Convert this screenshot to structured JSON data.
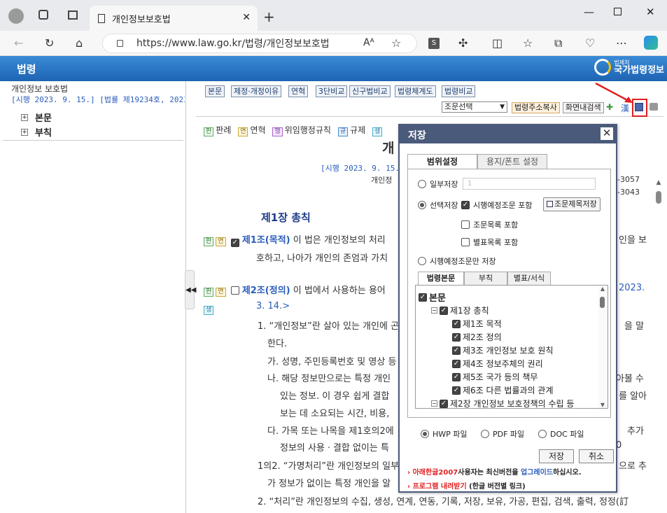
{
  "browser": {
    "tab_title": "개인정보보호법",
    "url_host": "https://www.law.go.kr",
    "url_path": "/법령/개인정보보호법"
  },
  "site": {
    "section": "법령",
    "logo_sub": "법제처",
    "logo_main": "국가법령정보"
  },
  "sidebar": {
    "law_name": "개인정보 보호법",
    "law_sub": "[시행 2023. 9. 15.] [법률 제19234호, 2023. 3.",
    "items": [
      {
        "label": "본문"
      },
      {
        "label": "부칙"
      }
    ]
  },
  "toolbar": {
    "buttons": [
      "본문",
      "제정·개정이유",
      "연혁",
      "3단비교",
      "신구법비교",
      "법령체계도",
      "법령비교"
    ],
    "jo_select": "조문선택",
    "addr_copy": "법령주소복사",
    "screen_search": "화면내검색",
    "hanja": "漢"
  },
  "tags": {
    "pan": "판",
    "yeon": "연",
    "haeng": "행",
    "gyu": "규",
    "saeng": "생",
    "pan_label": "판례",
    "yeon_label": "연혁",
    "haeng_label": "위임행정규칙",
    "gyu_label": "규제"
  },
  "law": {
    "title_partial": "개",
    "enforce_partial": "[시행 2023. 9. 15.] [",
    "ministry_partial": "개인정",
    "phone1": "-3057",
    "phone2": "-3043",
    "chapter": "제1장 총칙",
    "art1_head": "제1조(목적)",
    "art1_text": " 이 법은 개인정보의 처리",
    "art1_right": "인을 보",
    "art1_line2": "호하고, 나아가 개인의 존엄과 가치",
    "art2_head": "제2조(정의)",
    "art2_text": " 이 법에서 사용하는 용어",
    "art2_right": "2023.",
    "art2_line2": "3. 14.>",
    "l1": "1. “개인정보”란 살아 있는 개인에 곤",
    "l1r": "을 말",
    "l1b": "한다.",
    "l_ga": "가. 성명, 주민등록번호 및 영상 등",
    "l_na": "나. 해당 정보만으로는 특정 개인",
    "l_nar": "아볼 수",
    "l_na2": "있는 정보. 이 경우 쉽게 결합",
    "l_na2r": "를 알아",
    "l_na3": "보는 데 소요되는 시간, 비용,",
    "l_da": "다. 가목 또는 나목을 제1호의2에",
    "l_dar": "추가",
    "l_da2": "정보의 사용ㆍ결합 없이는 특",
    "l_da2r": "0",
    "l_12": "1의2. “가명처리”란 개인정보의 일부",
    "l_12r": "으로 추",
    "l_12b": "가 정보가 없이는 특정 개인을 알",
    "l_2": "2. “처리”란 개인정보의 수집, 생성, 연계, 연동, 기록, 저장, 보유, 가공, 편집, 검색, 출력, 정정(訂"
  },
  "dialog": {
    "title": "저장",
    "tabs": [
      "범위설정",
      "용지/폰트 설정"
    ],
    "partial_label": "일부저장",
    "partial_placeholder": "1",
    "select_label": "선택저장",
    "include_planned": "시행예정조문 포함",
    "jomok_save": "조문제목저장",
    "include_toc": "조문목록 포함",
    "include_table": "별표목록 포함",
    "planned_only": "시행예정조문만 저장",
    "inner_tabs": [
      "법령본문",
      "부칙",
      "별표/서식"
    ],
    "toc": [
      {
        "label": "본문",
        "level": 0
      },
      {
        "label": "제1장 총칙",
        "level": 1
      },
      {
        "label": "제1조 목적",
        "level": 2
      },
      {
        "label": "제2조 정의",
        "level": 2
      },
      {
        "label": "제3조 개인정보 보호 원칙",
        "level": 2
      },
      {
        "label": "제4조 정보주체의 권리",
        "level": 2
      },
      {
        "label": "제5조 국가 등의 책무",
        "level": 2
      },
      {
        "label": "제6조 다른 법률과의 관계",
        "level": 2
      },
      {
        "label": "제2장 개인정보 보호정책의 수립 등",
        "level": 1
      }
    ],
    "formats": [
      "HWP 파일",
      "PDF 파일",
      "DOC 파일"
    ],
    "save_button": "저장",
    "cancel_button": "취소",
    "note1_a": "아래한글2007",
    "note1_b": "사용자는 최신버전을 ",
    "note1_c": "업그레이드",
    "note1_d": "하십시오.",
    "note2_a": "프로그램 내려받기",
    "note2_b": " (한글 버전별 링크)"
  }
}
